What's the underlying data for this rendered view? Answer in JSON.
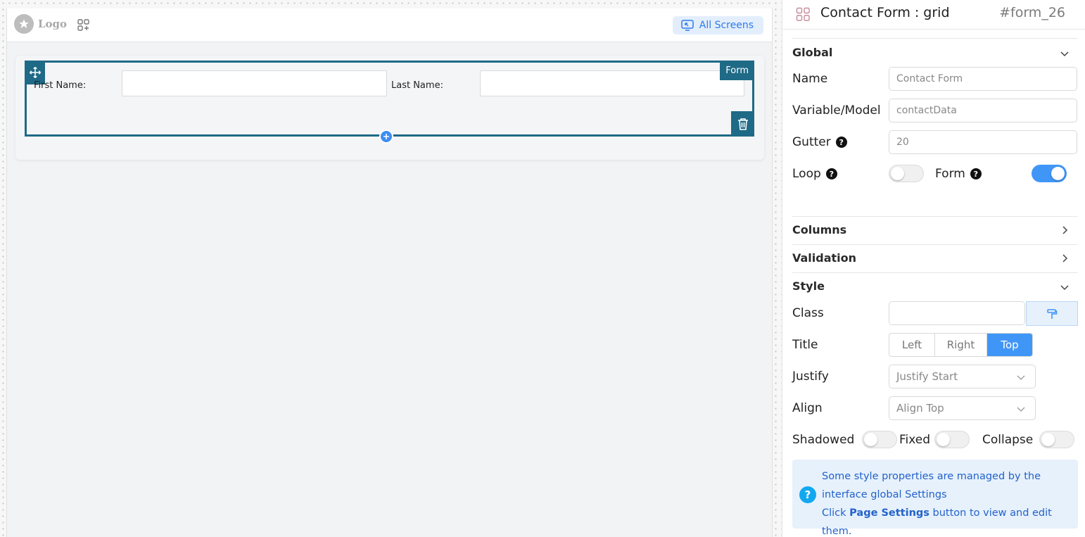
{
  "canvas": {
    "logo_text": "Logo",
    "all_screens_label": "All Screens",
    "form": {
      "tag_label": "Form",
      "fields": [
        {
          "label": "First Name:",
          "value": ""
        },
        {
          "label": "Last Name:",
          "value": ""
        }
      ]
    }
  },
  "panel": {
    "title": "Contact Form : grid",
    "id": "#form_26",
    "sections": {
      "global": "Global",
      "columns": "Columns",
      "validation": "Validation",
      "style": "Style"
    },
    "global": {
      "name_label": "Name",
      "name_value": "Contact Form",
      "variable_label": "Variable/Model",
      "variable_value": "contactData",
      "gutter_label": "Gutter",
      "gutter_value": "20",
      "loop_label": "Loop",
      "loop_on": false,
      "form_label": "Form",
      "form_on": true
    },
    "style": {
      "class_label": "Class",
      "class_value": "",
      "title_label": "Title",
      "title_options": [
        "Left",
        "Right",
        "Top"
      ],
      "title_selected": "Top",
      "justify_label": "Justify",
      "justify_value": "Justify Start",
      "align_label": "Align",
      "align_value": "Align Top",
      "shadowed_label": "Shadowed",
      "fixed_label": "Fixed",
      "collapse_label": "Collapse"
    },
    "info": {
      "line1": "Some style properties are managed by the",
      "line2": "interface global Settings",
      "line3_prefix": "Click ",
      "line3_bold": "Page Settings",
      "line3_suffix": " button to view and edit them."
    }
  },
  "colors": {
    "accent": "#4096f7",
    "frame": "#1f6a86",
    "info_bg": "#e6f1fc"
  }
}
